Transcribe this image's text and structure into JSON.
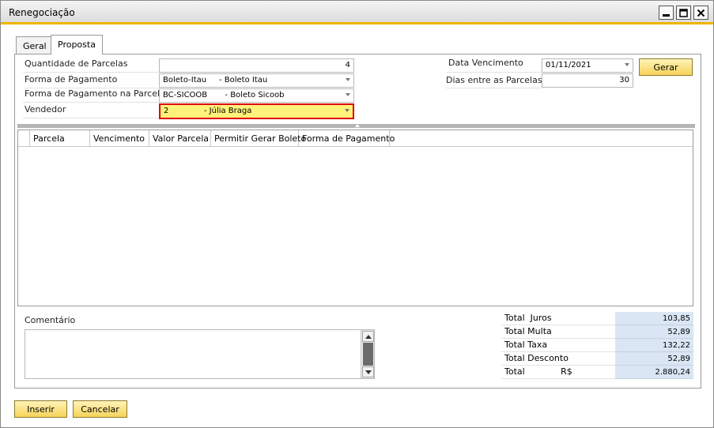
{
  "window": {
    "title": "Renegociação"
  },
  "tabs": [
    {
      "label": "Geral",
      "active": false
    },
    {
      "label": "Proposta",
      "active": true
    }
  ],
  "form": {
    "quantidade_label": "Quantidade de Parcelas",
    "quantidade_value": "4",
    "forma_pagamento_label": "Forma de Pagamento",
    "forma_pagamento_value": "Boleto-Itau     - Boleto Itau",
    "forma_parcela_label": "Forma de Pagamento na Parcela",
    "forma_parcela_value": "BC-SICOOB       - Boleto Sicoob",
    "vendedor_label": "Vendedor",
    "vendedor_value": "2              - Júlia Braga",
    "data_vencimento_label": "Data Vencimento",
    "data_vencimento_value": "01/11/2021",
    "dias_label": "Dias entre as Parcelas",
    "dias_value": "30",
    "gerar_label": "Gerar"
  },
  "grid": {
    "columns": [
      "",
      "Parcela",
      "Vencimento",
      "Valor Parcela",
      "Permitir Gerar Boleto",
      "Forma de Pagamento"
    ],
    "rows": []
  },
  "comentario": {
    "label": "Comentário",
    "value": ""
  },
  "totals": [
    {
      "label": "Total  Juros",
      "value": "103,85"
    },
    {
      "label": "Total Multa",
      "value": "52,89"
    },
    {
      "label": "Total Taxa",
      "value": "132,22"
    },
    {
      "label": "Total Desconto",
      "value": "52,89"
    },
    {
      "label": "Total             R$",
      "value": "2.880,24"
    }
  ],
  "buttons": {
    "inserir": "Inserir",
    "cancelar": "Cancelar"
  },
  "colors": {
    "accent": "#f0b400",
    "button": "#f6d35a",
    "highlight_field": "#fff27a",
    "highlight_border": "#e00000",
    "totals_bg": "#dbe6f4"
  }
}
